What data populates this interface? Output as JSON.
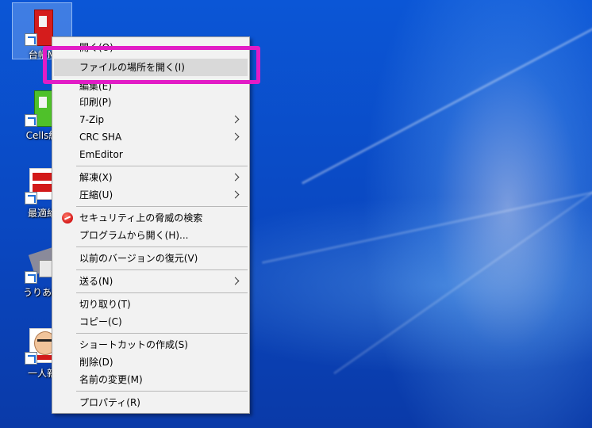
{
  "desktop": {
    "icons": [
      {
        "label": "台帳M"
      },
      {
        "label": "Cells給"
      },
      {
        "label": "最適給"
      },
      {
        "label": "うりあげ"
      },
      {
        "label": "一人親"
      }
    ]
  },
  "menu": {
    "items": [
      {
        "label": "開く(O)"
      },
      {
        "label": "ファイルの場所を開く(I)"
      },
      {
        "label": "編集(E)"
      },
      {
        "label": "印刷(P)"
      },
      {
        "label": "7-Zip"
      },
      {
        "label": "CRC SHA"
      },
      {
        "label": "EmEditor"
      },
      {
        "label": "解凍(X)"
      },
      {
        "label": "圧縮(U)"
      },
      {
        "label": "セキュリティ上の脅威の検索"
      },
      {
        "label": "プログラムから開く(H)..."
      },
      {
        "label": "以前のバージョンの復元(V)"
      },
      {
        "label": "送る(N)"
      },
      {
        "label": "切り取り(T)"
      },
      {
        "label": "コピー(C)"
      },
      {
        "label": "ショートカットの作成(S)"
      },
      {
        "label": "削除(D)"
      },
      {
        "label": "名前の変更(M)"
      },
      {
        "label": "プロパティ(R)"
      }
    ]
  },
  "colors": {
    "highlight_box": "#e21cc6",
    "menu_bg": "#f2f2f2",
    "hover_bg": "#d9d9d9"
  }
}
